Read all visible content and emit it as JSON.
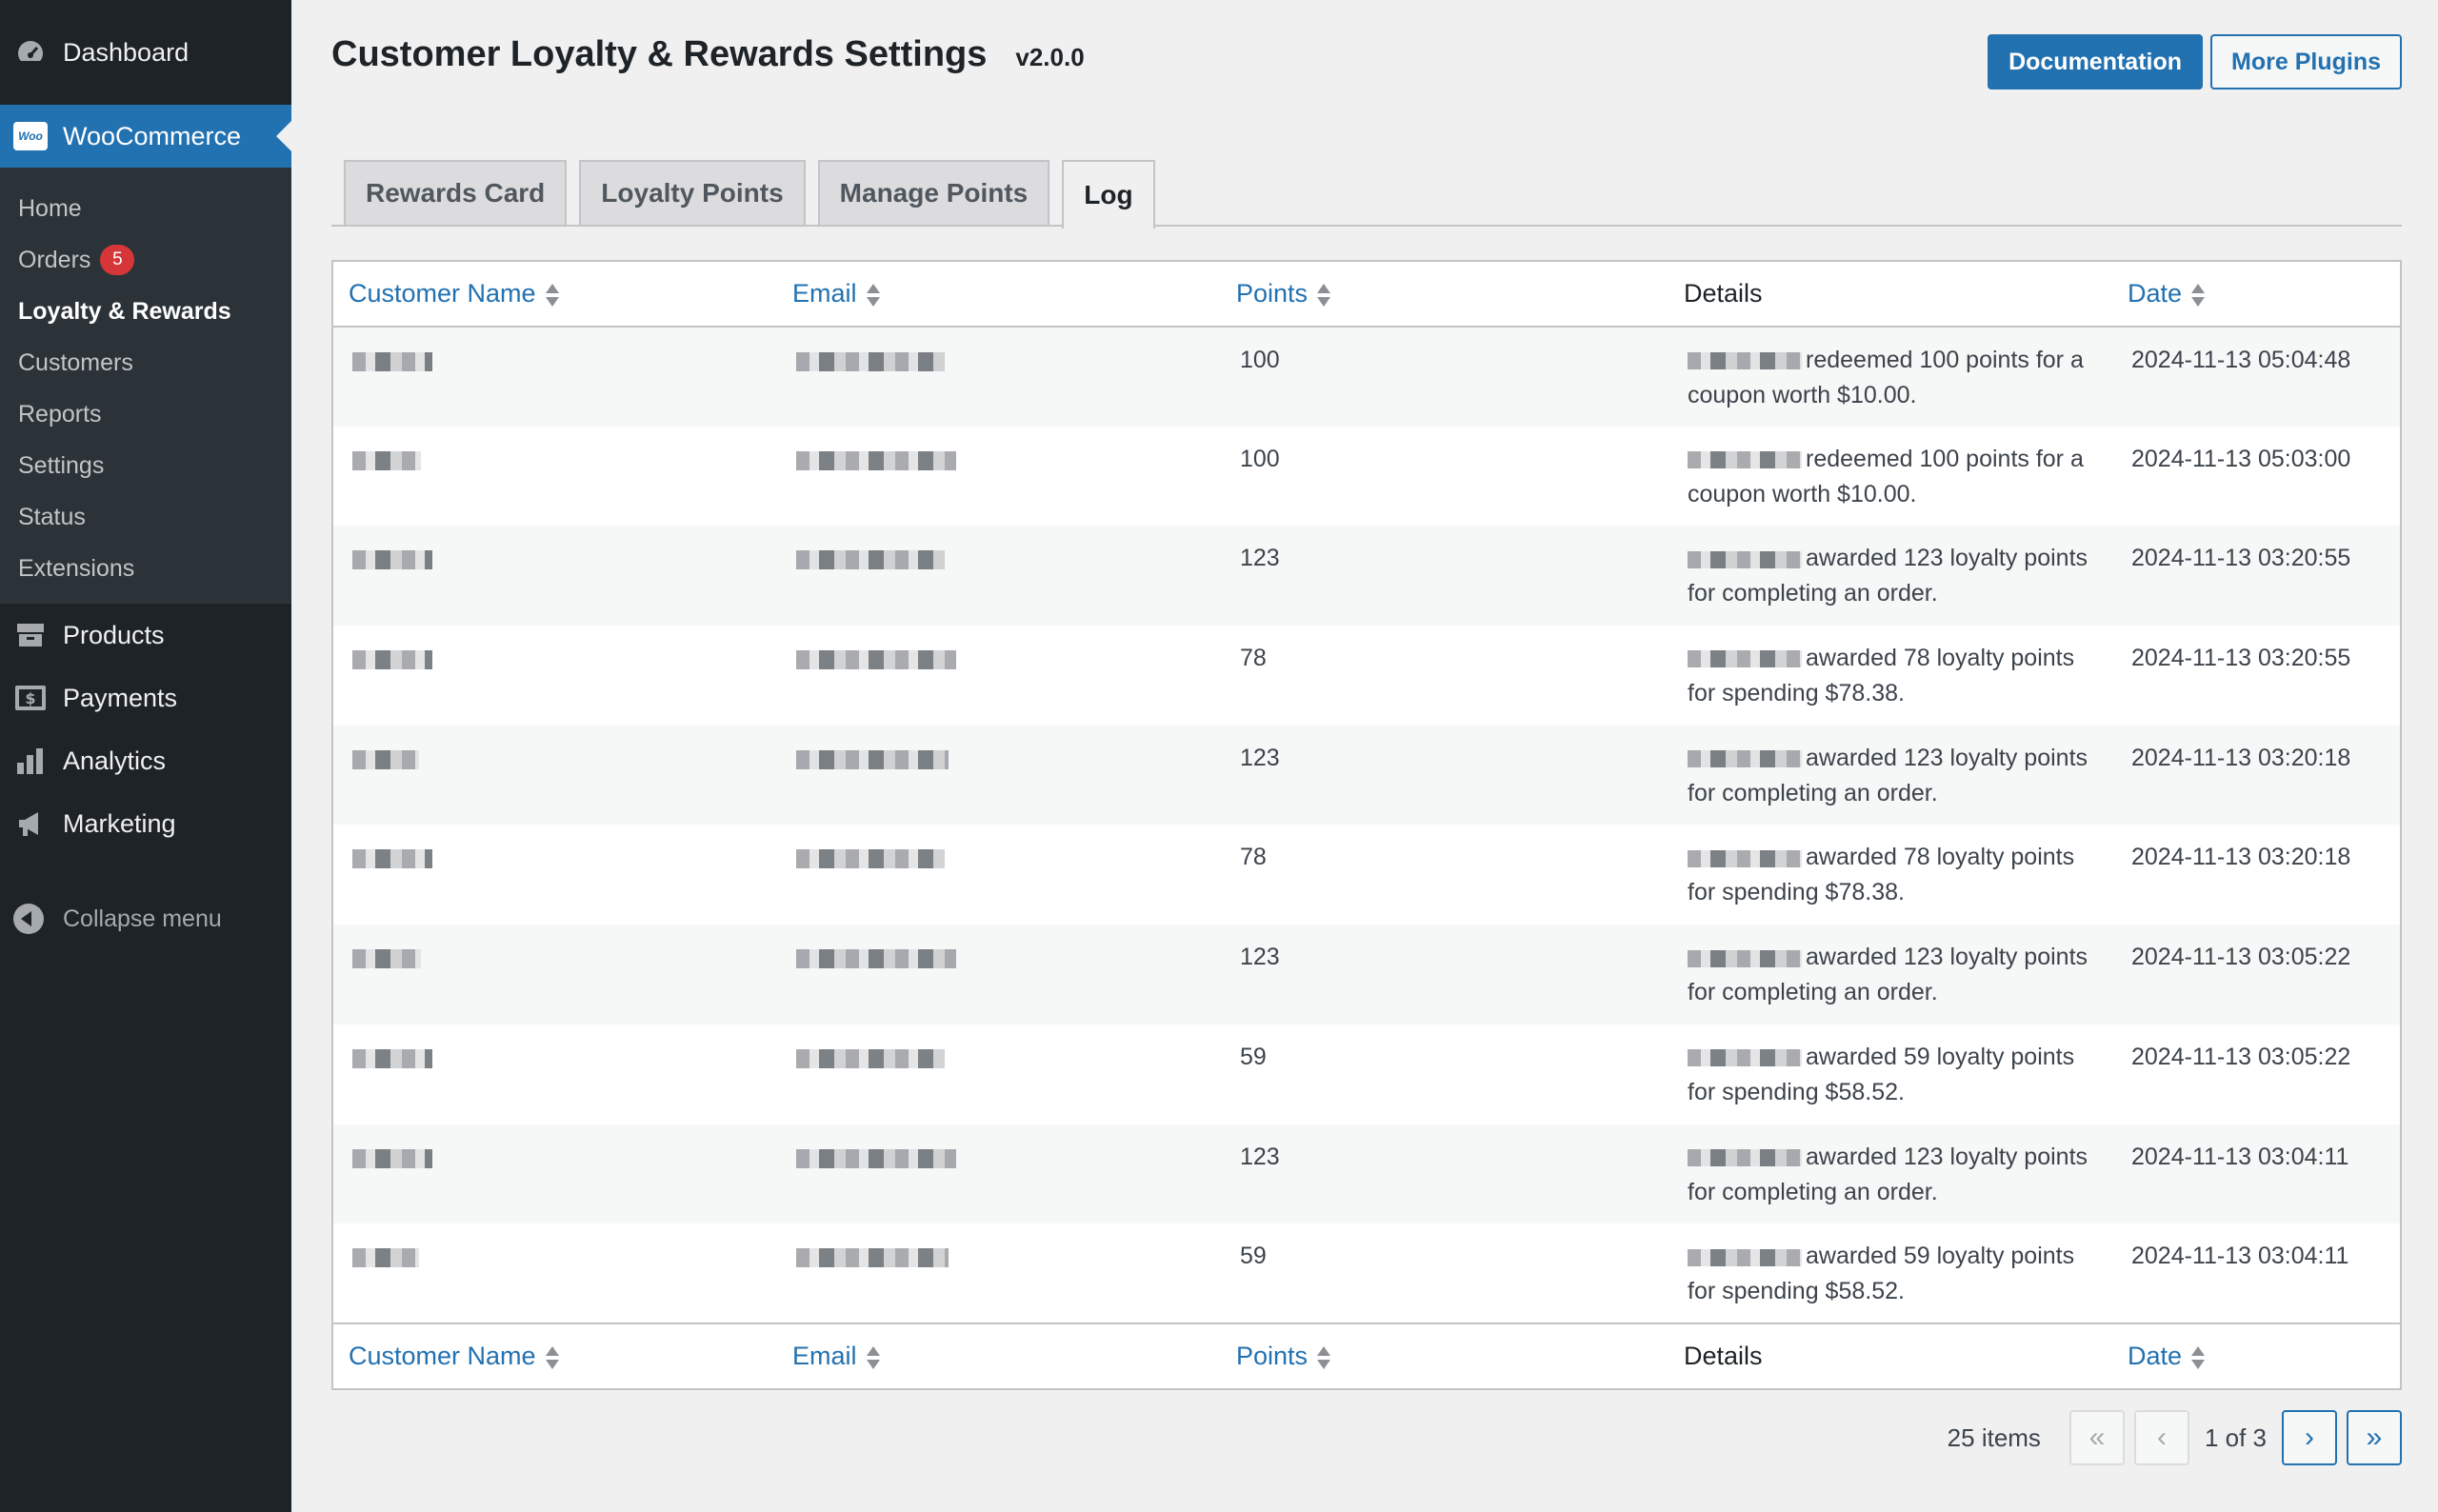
{
  "sidebar": {
    "dashboard": "Dashboard",
    "woocommerce": "WooCommerce",
    "woo_logo": "Woo",
    "submenu": [
      {
        "label": "Home"
      },
      {
        "label": "Orders",
        "badge": "5"
      },
      {
        "label": "Loyalty & Rewards",
        "current": true
      },
      {
        "label": "Customers"
      },
      {
        "label": "Reports"
      },
      {
        "label": "Settings"
      },
      {
        "label": "Status"
      },
      {
        "label": "Extensions"
      }
    ],
    "products": "Products",
    "payments": "Payments",
    "analytics": "Analytics",
    "marketing": "Marketing",
    "collapse": "Collapse menu"
  },
  "header": {
    "title": "Customer Loyalty & Rewards Settings",
    "version": "v2.0.0",
    "documentation_button": "Documentation",
    "more_plugins_button": "More Plugins"
  },
  "tabs": [
    "Rewards Card",
    "Loyalty Points",
    "Manage Points",
    "Log"
  ],
  "active_tab": "Log",
  "table": {
    "columns": [
      "Customer Name",
      "Email",
      "Points",
      "Details",
      "Date"
    ],
    "rows": [
      {
        "points": "100",
        "details": "redeemed 100 points for a coupon worth $10.00.",
        "date": "2024-11-13 05:04:48"
      },
      {
        "points": "100",
        "details": "redeemed 100 points for a coupon worth $10.00.",
        "date": "2024-11-13 05:03:00"
      },
      {
        "points": "123",
        "details": "awarded 123 loyalty points for completing an order.",
        "date": "2024-11-13 03:20:55"
      },
      {
        "points": "78",
        "details": "awarded 78 loyalty points for spending $78.38.",
        "date": "2024-11-13 03:20:55"
      },
      {
        "points": "123",
        "details": "awarded 123 loyalty points for completing an order.",
        "date": "2024-11-13 03:20:18"
      },
      {
        "points": "78",
        "details": "awarded 78 loyalty points for spending $78.38.",
        "date": "2024-11-13 03:20:18"
      },
      {
        "points": "123",
        "details": "awarded 123 loyalty points for completing an order.",
        "date": "2024-11-13 03:05:22"
      },
      {
        "points": "59",
        "details": "awarded 59 loyalty points for spending $58.52.",
        "date": "2024-11-13 03:05:22"
      },
      {
        "points": "123",
        "details": "awarded 123 loyalty points for completing an order.",
        "date": "2024-11-13 03:04:11"
      },
      {
        "points": "59",
        "details": "awarded 59 loyalty points for spending $58.52.",
        "date": "2024-11-13 03:04:11"
      }
    ]
  },
  "pagination": {
    "items": "25 items",
    "status": "1 of 3",
    "first": "«",
    "prev": "‹",
    "next": "›",
    "last": "»"
  },
  "colors": {
    "sidebar_bg": "#1d2327",
    "accent": "#2271b1",
    "badge": "#d63638"
  }
}
